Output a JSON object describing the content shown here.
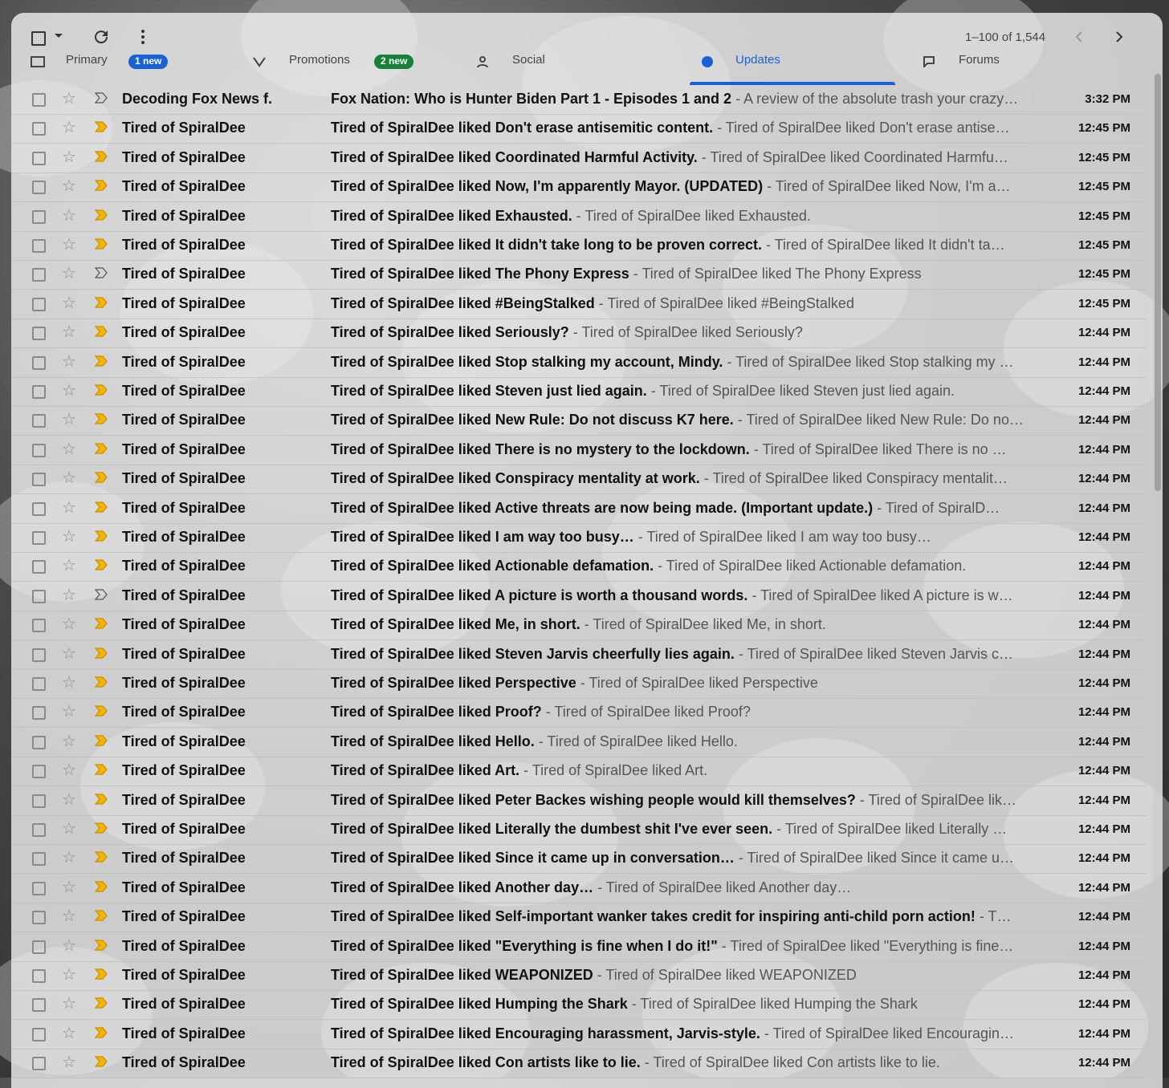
{
  "toolbar": {
    "page_count": "1–100 of 1,544"
  },
  "tabs": [
    {
      "label": "Primary",
      "badge": "1 new",
      "badge_color": "#1a62d4"
    },
    {
      "label": "Promotions",
      "badge": "2 new",
      "badge_color": "#188038"
    },
    {
      "label": "Social",
      "badge": ""
    },
    {
      "label": "Updates",
      "badge": ""
    },
    {
      "label": "Forums",
      "badge": ""
    }
  ],
  "selected_tab": "Updates",
  "colors": {
    "accent": "#1a62d4",
    "important_marker": "#f4b400"
  },
  "emails": [
    {
      "sender": "Decoding Fox News f.",
      "subject": "Fox Nation: Who is Hunter Biden Part 1 - Episodes 1 and 2",
      "snippet": "A review of the absolute trash your crazy…",
      "time": "3:32 PM",
      "important": false
    },
    {
      "sender": "Tired of SpiralDee",
      "subject": "Tired of SpiralDee liked Don't erase antisemitic content.",
      "snippet": "Tired of SpiralDee liked Don't erase antise…",
      "time": "12:45 PM",
      "important": true
    },
    {
      "sender": "Tired of SpiralDee",
      "subject": "Tired of SpiralDee liked Coordinated Harmful Activity.",
      "snippet": "Tired of SpiralDee liked Coordinated Harmfu…",
      "time": "12:45 PM",
      "important": true
    },
    {
      "sender": "Tired of SpiralDee",
      "subject": "Tired of SpiralDee liked Now, I'm apparently Mayor. (UPDATED)",
      "snippet": "Tired of SpiralDee liked Now, I'm a…",
      "time": "12:45 PM",
      "important": true
    },
    {
      "sender": "Tired of SpiralDee",
      "subject": "Tired of SpiralDee liked Exhausted.",
      "snippet": "Tired of SpiralDee liked Exhausted.",
      "time": "12:45 PM",
      "important": true
    },
    {
      "sender": "Tired of SpiralDee",
      "subject": "Tired of SpiralDee liked It didn't take long to be proven correct.",
      "snippet": "Tired of SpiralDee liked It didn't ta…",
      "time": "12:45 PM",
      "important": true
    },
    {
      "sender": "Tired of SpiralDee",
      "subject": "Tired of SpiralDee liked The Phony Express",
      "snippet": "Tired of SpiralDee liked The Phony Express",
      "time": "12:45 PM",
      "important": false
    },
    {
      "sender": "Tired of SpiralDee",
      "subject": "Tired of SpiralDee liked #BeingStalked",
      "snippet": "Tired of SpiralDee liked #BeingStalked",
      "time": "12:45 PM",
      "important": true
    },
    {
      "sender": "Tired of SpiralDee",
      "subject": "Tired of SpiralDee liked Seriously?",
      "snippet": "Tired of SpiralDee liked Seriously?",
      "time": "12:44 PM",
      "important": true
    },
    {
      "sender": "Tired of SpiralDee",
      "subject": "Tired of SpiralDee liked Stop stalking my account, Mindy.",
      "snippet": "Tired of SpiralDee liked Stop stalking my …",
      "time": "12:44 PM",
      "important": true
    },
    {
      "sender": "Tired of SpiralDee",
      "subject": "Tired of SpiralDee liked Steven just lied again.",
      "snippet": "Tired of SpiralDee liked Steven just lied again.",
      "time": "12:44 PM",
      "important": true
    },
    {
      "sender": "Tired of SpiralDee",
      "subject": "Tired of SpiralDee liked New Rule: Do not discuss K7 here.",
      "snippet": "Tired of SpiralDee liked New Rule: Do no…",
      "time": "12:44 PM",
      "important": true
    },
    {
      "sender": "Tired of SpiralDee",
      "subject": "Tired of SpiralDee liked There is no mystery to the lockdown.",
      "snippet": "Tired of SpiralDee liked There is no …",
      "time": "12:44 PM",
      "important": true
    },
    {
      "sender": "Tired of SpiralDee",
      "subject": "Tired of SpiralDee liked Conspiracy mentality at work.",
      "snippet": "Tired of SpiralDee liked Conspiracy mentalit…",
      "time": "12:44 PM",
      "important": true
    },
    {
      "sender": "Tired of SpiralDee",
      "subject": "Tired of SpiralDee liked Active threats are now being made. (Important update.)",
      "snippet": "Tired of SpiralD…",
      "time": "12:44 PM",
      "important": true
    },
    {
      "sender": "Tired of SpiralDee",
      "subject": "Tired of SpiralDee liked I am way too busy…",
      "snippet": "Tired of SpiralDee liked I am way too busy…",
      "time": "12:44 PM",
      "important": true
    },
    {
      "sender": "Tired of SpiralDee",
      "subject": "Tired of SpiralDee liked Actionable defamation.",
      "snippet": "Tired of SpiralDee liked Actionable defamation.",
      "time": "12:44 PM",
      "important": true
    },
    {
      "sender": "Tired of SpiralDee",
      "subject": "Tired of SpiralDee liked A picture is worth a thousand words.",
      "snippet": "Tired of SpiralDee liked A picture is w…",
      "time": "12:44 PM",
      "important": false
    },
    {
      "sender": "Tired of SpiralDee",
      "subject": "Tired of SpiralDee liked Me, in short.",
      "snippet": "Tired of SpiralDee liked Me, in short.",
      "time": "12:44 PM",
      "important": true
    },
    {
      "sender": "Tired of SpiralDee",
      "subject": "Tired of SpiralDee liked Steven Jarvis cheerfully lies again.",
      "snippet": "Tired of SpiralDee liked Steven Jarvis c…",
      "time": "12:44 PM",
      "important": true
    },
    {
      "sender": "Tired of SpiralDee",
      "subject": "Tired of SpiralDee liked Perspective",
      "snippet": "Tired of SpiralDee liked Perspective",
      "time": "12:44 PM",
      "important": true
    },
    {
      "sender": "Tired of SpiralDee",
      "subject": "Tired of SpiralDee liked Proof?",
      "snippet": "Tired of SpiralDee liked Proof?",
      "time": "12:44 PM",
      "important": true
    },
    {
      "sender": "Tired of SpiralDee",
      "subject": "Tired of SpiralDee liked Hello.",
      "snippet": "Tired of SpiralDee liked Hello.",
      "time": "12:44 PM",
      "important": true
    },
    {
      "sender": "Tired of SpiralDee",
      "subject": "Tired of SpiralDee liked Art.",
      "snippet": "Tired of SpiralDee liked Art.",
      "time": "12:44 PM",
      "important": true
    },
    {
      "sender": "Tired of SpiralDee",
      "subject": "Tired of SpiralDee liked Peter Backes wishing people would kill themselves?",
      "snippet": "Tired of SpiralDee lik…",
      "time": "12:44 PM",
      "important": true
    },
    {
      "sender": "Tired of SpiralDee",
      "subject": "Tired of SpiralDee liked Literally the dumbest shit I've ever seen.",
      "snippet": "Tired of SpiralDee liked Literally …",
      "time": "12:44 PM",
      "important": true
    },
    {
      "sender": "Tired of SpiralDee",
      "subject": "Tired of SpiralDee liked Since it came up in conversation…",
      "snippet": "Tired of SpiralDee liked Since it came u…",
      "time": "12:44 PM",
      "important": true
    },
    {
      "sender": "Tired of SpiralDee",
      "subject": "Tired of SpiralDee liked Another day…",
      "snippet": "Tired of SpiralDee liked Another day…",
      "time": "12:44 PM",
      "important": true
    },
    {
      "sender": "Tired of SpiralDee",
      "subject": "Tired of SpiralDee liked Self-important wanker takes credit for inspiring anti-child porn action!",
      "snippet": "T…",
      "time": "12:44 PM",
      "important": true
    },
    {
      "sender": "Tired of SpiralDee",
      "subject": "Tired of SpiralDee liked \"Everything is fine when I do it!\"",
      "snippet": "Tired of SpiralDee liked \"Everything is fine…",
      "time": "12:44 PM",
      "important": true
    },
    {
      "sender": "Tired of SpiralDee",
      "subject": "Tired of SpiralDee liked WEAPONIZED",
      "snippet": "Tired of SpiralDee liked WEAPONIZED",
      "time": "12:44 PM",
      "important": true
    },
    {
      "sender": "Tired of SpiralDee",
      "subject": "Tired of SpiralDee liked Humping the Shark",
      "snippet": "Tired of SpiralDee liked Humping the Shark",
      "time": "12:44 PM",
      "important": true
    },
    {
      "sender": "Tired of SpiralDee",
      "subject": "Tired of SpiralDee liked Encouraging harassment, Jarvis-style.",
      "snippet": "Tired of SpiralDee liked Encouragin…",
      "time": "12:44 PM",
      "important": true
    },
    {
      "sender": "Tired of SpiralDee",
      "subject": "Tired of SpiralDee liked Con artists like to lie.",
      "snippet": "Tired of SpiralDee liked Con artists like to lie.",
      "time": "12:44 PM",
      "important": true
    }
  ]
}
